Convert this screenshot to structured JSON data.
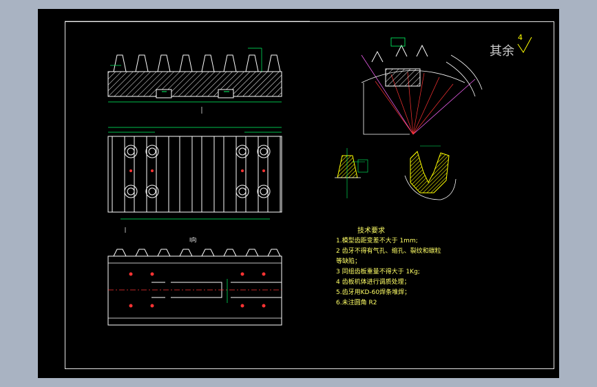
{
  "drawing": {
    "surface_roughness": {
      "label": "其余",
      "value": "4"
    },
    "view_label": "I向",
    "tech_requirements": {
      "title": "技术要求",
      "items": [
        "1.模型齿距变差不大于 1mm;",
        "2 齿牙不得有气孔、缩孔、裂纹和碳粒",
        "等缺陷；",
        "3 同组齿板重量不得大于 1Kg;",
        "4 齿板机体进行调质处理；",
        "5.齿牙用KD-60焊条堆焊；",
        "6.未注圆角 R2"
      ]
    },
    "colors": {
      "background": "#000000",
      "outer": "#a9b3c2",
      "line": "#ffffff",
      "dimension": "#00ff66",
      "centerline": "#ff3333",
      "highlight": "#ffff00",
      "aux": "#ff66ff"
    }
  }
}
